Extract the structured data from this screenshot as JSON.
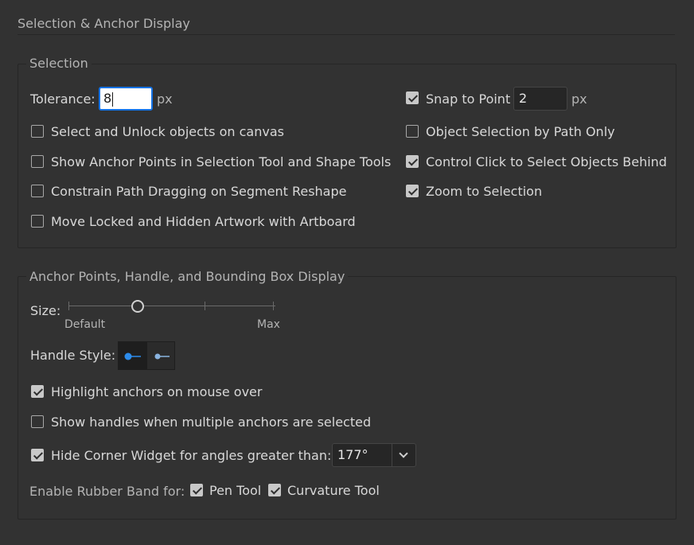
{
  "header": {
    "title": "Selection & Anchor Display"
  },
  "selection": {
    "legend": "Selection",
    "tolerance": {
      "label": "Tolerance:",
      "value": "8",
      "unit": "px"
    },
    "snap_to_point": {
      "label": "Snap to Point",
      "checked": true,
      "value": "2",
      "unit": "px"
    },
    "left_options": [
      {
        "label": "Select and Unlock objects on canvas",
        "checked": false
      },
      {
        "label": "Show Anchor Points in Selection Tool and Shape Tools",
        "checked": false
      },
      {
        "label": "Constrain Path Dragging on Segment Reshape",
        "checked": false
      },
      {
        "label": "Move Locked and Hidden Artwork with Artboard",
        "checked": false
      }
    ],
    "right_options": [
      {
        "label": "Object Selection by Path Only",
        "checked": false
      },
      {
        "label": "Control Click to Select Objects Behind",
        "checked": true
      },
      {
        "label": "Zoom to Selection",
        "checked": true
      }
    ]
  },
  "anchor": {
    "legend": "Anchor Points, Handle, and Bounding Box Display",
    "size": {
      "label": "Size:",
      "min_label": "Default",
      "max_label": "Max",
      "level_fraction": 0.33
    },
    "handle_style": {
      "label": "Handle Style:",
      "options": [
        {
          "icon": "handle-solid-icon",
          "selected": true
        },
        {
          "icon": "handle-hollow-icon",
          "selected": false
        }
      ]
    },
    "highlight_anchors": {
      "label": "Highlight anchors on mouse over",
      "checked": true
    },
    "show_handles": {
      "label": "Show handles when multiple anchors are selected",
      "checked": false
    },
    "hide_corner_widget": {
      "label": "Hide Corner Widget for angles greater than:",
      "checked": true,
      "value": "177°"
    },
    "rubber_band": {
      "label": "Enable Rubber Band for:",
      "pen_tool": {
        "label": "Pen Tool",
        "checked": true
      },
      "curvature_tool": {
        "label": "Curvature Tool",
        "checked": true
      }
    }
  },
  "colors": {
    "background": "#323232",
    "focus_ring": "#1473e6",
    "accent_blue": "#2d8ceb"
  }
}
